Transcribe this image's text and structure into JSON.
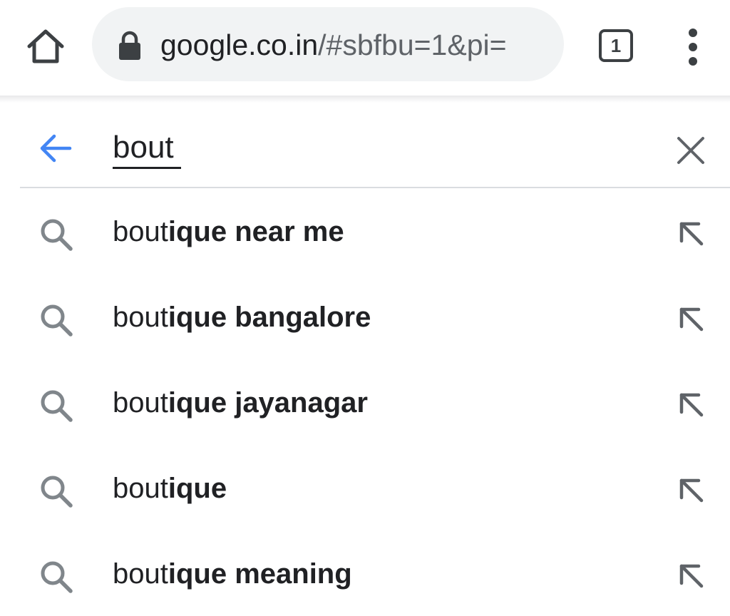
{
  "toolbar": {
    "home_icon": "home-icon",
    "url_host": "google.co.in",
    "url_path": "/#sbfbu=1&pi=",
    "tab_count": "1"
  },
  "search": {
    "query": "bout",
    "back_icon": "arrow-left-icon",
    "clear_icon": "close-icon",
    "accent_color": "#4285f4"
  },
  "suggestions": [
    {
      "typed": "bout",
      "completion": "ique near me"
    },
    {
      "typed": "bout",
      "completion": "ique bangalore"
    },
    {
      "typed": "bout",
      "completion": "ique jayanagar"
    },
    {
      "typed": "bout",
      "completion": "ique"
    },
    {
      "typed": "bout",
      "completion": "ique meaning"
    }
  ]
}
